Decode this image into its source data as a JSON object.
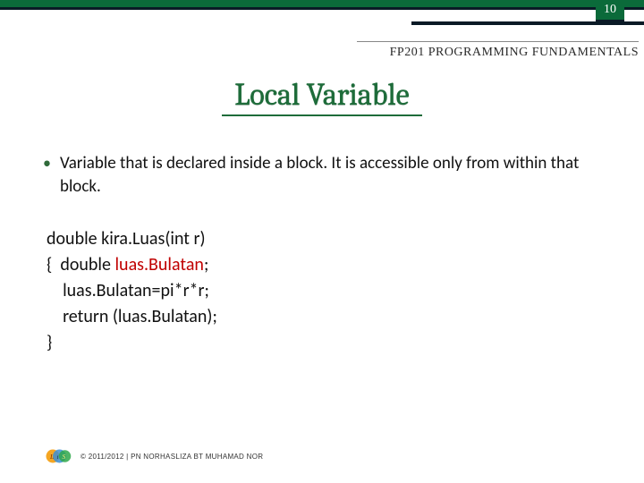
{
  "page_number": "10",
  "course_code": "FP201 PROGRAMMING FUNDAMENTALS",
  "title": "Local Variable",
  "bullet_text": "Variable that is declared inside a block. It is accessible only from within that block.",
  "code": {
    "l1a": "double kira.Luas(int r)",
    "l2a": "{  double ",
    "l2b": "luas.Bulatan",
    "l2c": ";",
    "l3a": "    luas.Bulatan=pi*r*r;",
    "l4a": "    return (luas.Bulatan);",
    "l5a": "}"
  },
  "copyright": "© 2011/2012 | PN NORHASLIZA BT MUHAMAD NOR",
  "colors": {
    "brand_green": "#0b6a3a",
    "title_green": "#1e6c3a",
    "dark_bar": "#0a1a26",
    "var_red": "#c00000"
  }
}
